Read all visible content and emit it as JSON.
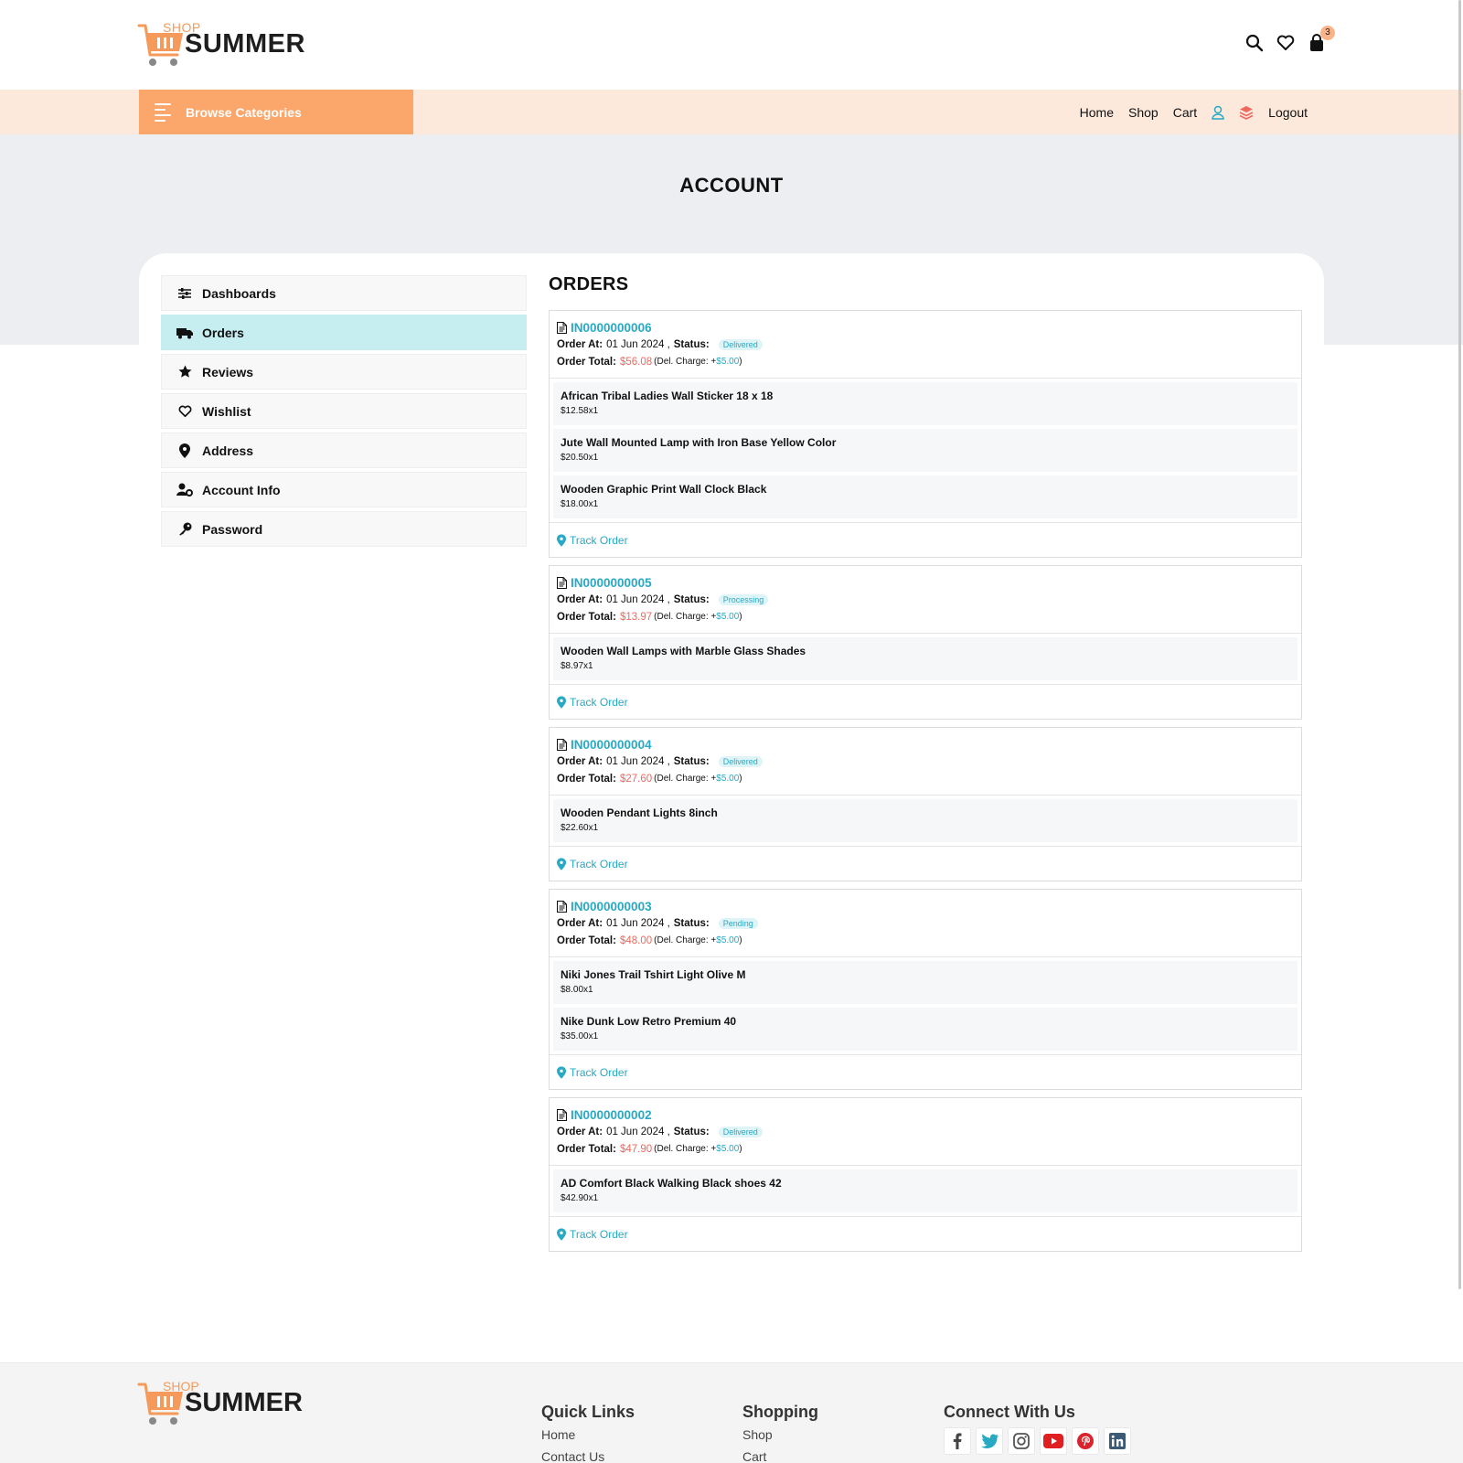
{
  "header": {
    "logo_shop": "SHOP",
    "logo_summer": "SUMMER",
    "cart_count": "3"
  },
  "navbar": {
    "browse_label": "Browse Categories",
    "links": [
      "Home",
      "Shop",
      "Cart",
      "Logout"
    ]
  },
  "banner": {
    "title": "ACCOUNT"
  },
  "sidebar": {
    "items": [
      {
        "label": "Dashboards",
        "icon": "sliders-icon"
      },
      {
        "label": "Orders",
        "icon": "truck-icon",
        "active": true
      },
      {
        "label": "Reviews",
        "icon": "star-icon"
      },
      {
        "label": "Wishlist",
        "icon": "heart-icon"
      },
      {
        "label": "Address",
        "icon": "location-pin-icon"
      },
      {
        "label": "Account Info",
        "icon": "user-gear-icon"
      },
      {
        "label": "Password",
        "icon": "key-icon"
      }
    ]
  },
  "orders": {
    "title": "ORDERS",
    "order_at_label": "Order At:",
    "status_label": "Status:",
    "total_label": "Order Total:",
    "del_charge_label": "Del. Charge: +",
    "track_label": "Track Order",
    "list": [
      {
        "id": "IN0000000006",
        "date": "01 Jun 2024 ,",
        "status": "Delivered",
        "total": "$56.08",
        "delivery": "$5.00",
        "items": [
          {
            "name": "African Tribal Ladies Wall Sticker 18 x 18",
            "price": "$12.58x1"
          },
          {
            "name": "Jute Wall Mounted Lamp with Iron Base Yellow Color",
            "price": "$20.50x1"
          },
          {
            "name": "Wooden Graphic Print Wall Clock Black",
            "price": "$18.00x1"
          }
        ]
      },
      {
        "id": "IN0000000005",
        "date": "01 Jun 2024 ,",
        "status": "Processing",
        "total": "$13.97",
        "delivery": "$5.00",
        "items": [
          {
            "name": "Wooden Wall Lamps with Marble Glass Shades",
            "price": "$8.97x1"
          }
        ]
      },
      {
        "id": "IN0000000004",
        "date": "01 Jun 2024 ,",
        "status": "Delivered",
        "total": "$27.60",
        "delivery": "$5.00",
        "items": [
          {
            "name": "Wooden Pendant Lights 8inch",
            "price": "$22.60x1"
          }
        ]
      },
      {
        "id": "IN0000000003",
        "date": "01 Jun 2024 ,",
        "status": "Pending",
        "total": "$48.00",
        "delivery": "$5.00",
        "items": [
          {
            "name": "Niki Jones Trail Tshirt Light Olive M",
            "price": "$8.00x1"
          },
          {
            "name": "Nike Dunk Low Retro Premium 40",
            "price": "$35.00x1"
          }
        ]
      },
      {
        "id": "IN0000000002",
        "date": "01 Jun 2024 ,",
        "status": "Delivered",
        "total": "$47.90",
        "delivery": "$5.00",
        "items": [
          {
            "name": "AD Comfort Black Walking Black shoes 42",
            "price": "$42.90x1"
          }
        ]
      }
    ]
  },
  "footer": {
    "quick_links_title": "Quick Links",
    "quick_links": [
      "Home",
      "Contact Us"
    ],
    "shopping_title": "Shopping",
    "shopping_links": [
      "Shop",
      "Cart"
    ],
    "connect_title": "Connect With Us",
    "socials": [
      "facebook-icon",
      "twitter-icon",
      "instagram-icon",
      "youtube-icon",
      "pinterest-icon",
      "linkedin-icon"
    ]
  },
  "colors": {
    "accent_orange": "#fba66b",
    "accent_blue": "#27a9c3",
    "price_red": "#f0675e",
    "active_sidebar": "#c6edf0"
  }
}
